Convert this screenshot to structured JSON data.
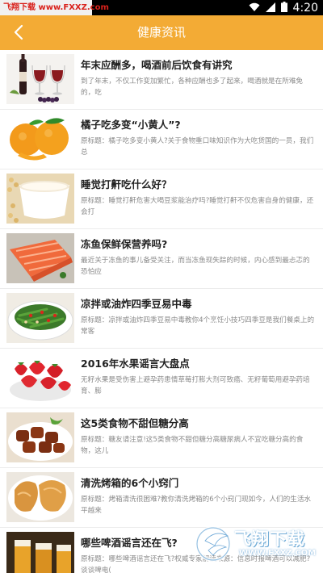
{
  "status_bar": {
    "watermark_brand": "飞翔下载",
    "watermark_url": "www.FXXZ.com",
    "time": "4:20"
  },
  "header": {
    "title": "健康资讯",
    "back_icon": "chevron-left-icon"
  },
  "colors": {
    "accent": "#f3ab35",
    "title_text": "#222222",
    "summary_text": "#8a8a8a"
  },
  "articles": [
    {
      "title": "年末应酬多，喝酒前后饮食有讲究",
      "summary": "到了年末，不仅工作变加繁忙，各种应酬也多了起来，喝酒就是在所难免的，吃",
      "thumb": "wine"
    },
    {
      "title": "橘子吃多变“小黄人”?",
      "summary": "原标题：橘子吃多变小黄人?关于食物重口味知识作为大吃货国的一员，我们总",
      "thumb": "oranges"
    },
    {
      "title": "睡觉打鼾吃什么好？",
      "summary": "原标题：睡觉打鼾危害大喝豆浆能治疗吗?睡觉打鼾不仅危害自身的健康，还会打",
      "thumb": "soymilk"
    },
    {
      "title": "冻鱼保鲜保营养吗?",
      "summary": "最近关于冻鱼的事儿备受关注，而当冻鱼现失踪的时候，内心感到最忐忑的恐怕应",
      "thumb": "salmon"
    },
    {
      "title": "凉拌或油炸四季豆易中毒",
      "summary": "原标题：凉拌或油炸四季豆易中毒教你4个烹饪小技巧四季豆是我们餐桌上的常客",
      "thumb": "beans"
    },
    {
      "title": "2016年水果谣言大盘点",
      "summary": "无籽水果是受伤害上避孕药患情草莓打膨大剂可致癌、无籽葡萄用避孕药培育、膨",
      "thumb": "strawberries"
    },
    {
      "title": "这5类食物不甜但糖分高",
      "summary": "原标题：糖友请注意!这5类食物不甜但糖分高糖尿病人不宜吃糖分高的食物，这儿",
      "thumb": "meat"
    },
    {
      "title": "清洗烤箱的6个小窍门",
      "summary": "原标题：烤箱清洗很困难?教你清洗烤箱的6个小窍门现如今，人们的生活水平越来",
      "thumb": "bread"
    },
    {
      "title": "哪些啤酒谣言还在飞?",
      "summary": "原标题：哪些啤酒谣言还在飞?权威专家解读来源：信息时报啤酒可以减肥?谈谈啤电(",
      "thumb": "beer"
    }
  ],
  "watermark": {
    "logo_text": "飞翔下载",
    "url": "WWW.FXXZ.COM"
  }
}
